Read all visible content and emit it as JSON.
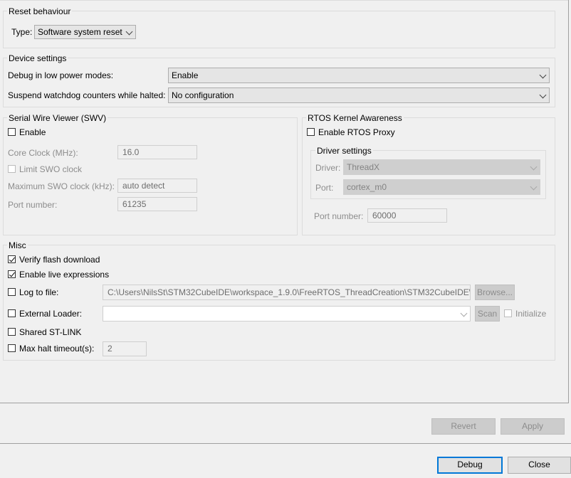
{
  "reset_behaviour": {
    "title": "Reset behaviour",
    "type_label": "Type:",
    "type_value": "Software system reset"
  },
  "device_settings": {
    "title": "Device settings",
    "debug_low_power_label": "Debug in low power modes:",
    "debug_low_power_value": "Enable",
    "suspend_watchdog_label": "Suspend watchdog counters while halted:",
    "suspend_watchdog_value": "No configuration"
  },
  "swv": {
    "title": "Serial Wire Viewer (SWV)",
    "enable_label": "Enable",
    "enable_checked": false,
    "core_clock_label": "Core Clock (MHz):",
    "core_clock_value": "16.0",
    "limit_swo_label": "Limit SWO clock",
    "max_swo_label": "Maximum SWO clock (kHz):",
    "max_swo_value": "auto detect",
    "port_label": "Port number:",
    "port_value": "61235"
  },
  "rtos": {
    "title": "RTOS Kernel Awareness",
    "enable_proxy_label": "Enable RTOS Proxy",
    "driver_settings_title": "Driver settings",
    "driver_label": "Driver:",
    "driver_value": "ThreadX",
    "port_label": "Port:",
    "port_value": "cortex_m0",
    "port_number_label": "Port number:",
    "port_number_value": "60000"
  },
  "misc": {
    "title": "Misc",
    "verify_flash_label": "Verify flash download",
    "live_expressions_label": "Enable live expressions",
    "log_to_file_label": "Log to file:",
    "log_path": "C:\\Users\\NilsSt\\STM32CubeIDE\\workspace_1.9.0\\FreeRTOS_ThreadCreation\\STM32CubeIDE\\Debu",
    "browse_label": "Browse...",
    "external_loader_label": "External Loader:",
    "external_loader_value": "",
    "scan_label": "Scan",
    "initialize_label": "Initialize",
    "shared_stlink_label": "Shared ST-LINK",
    "max_halt_label": "Max halt timeout(s):",
    "max_halt_value": "2"
  },
  "buttons": {
    "revert": "Revert",
    "apply": "Apply",
    "debug": "Debug",
    "close": "Close"
  }
}
